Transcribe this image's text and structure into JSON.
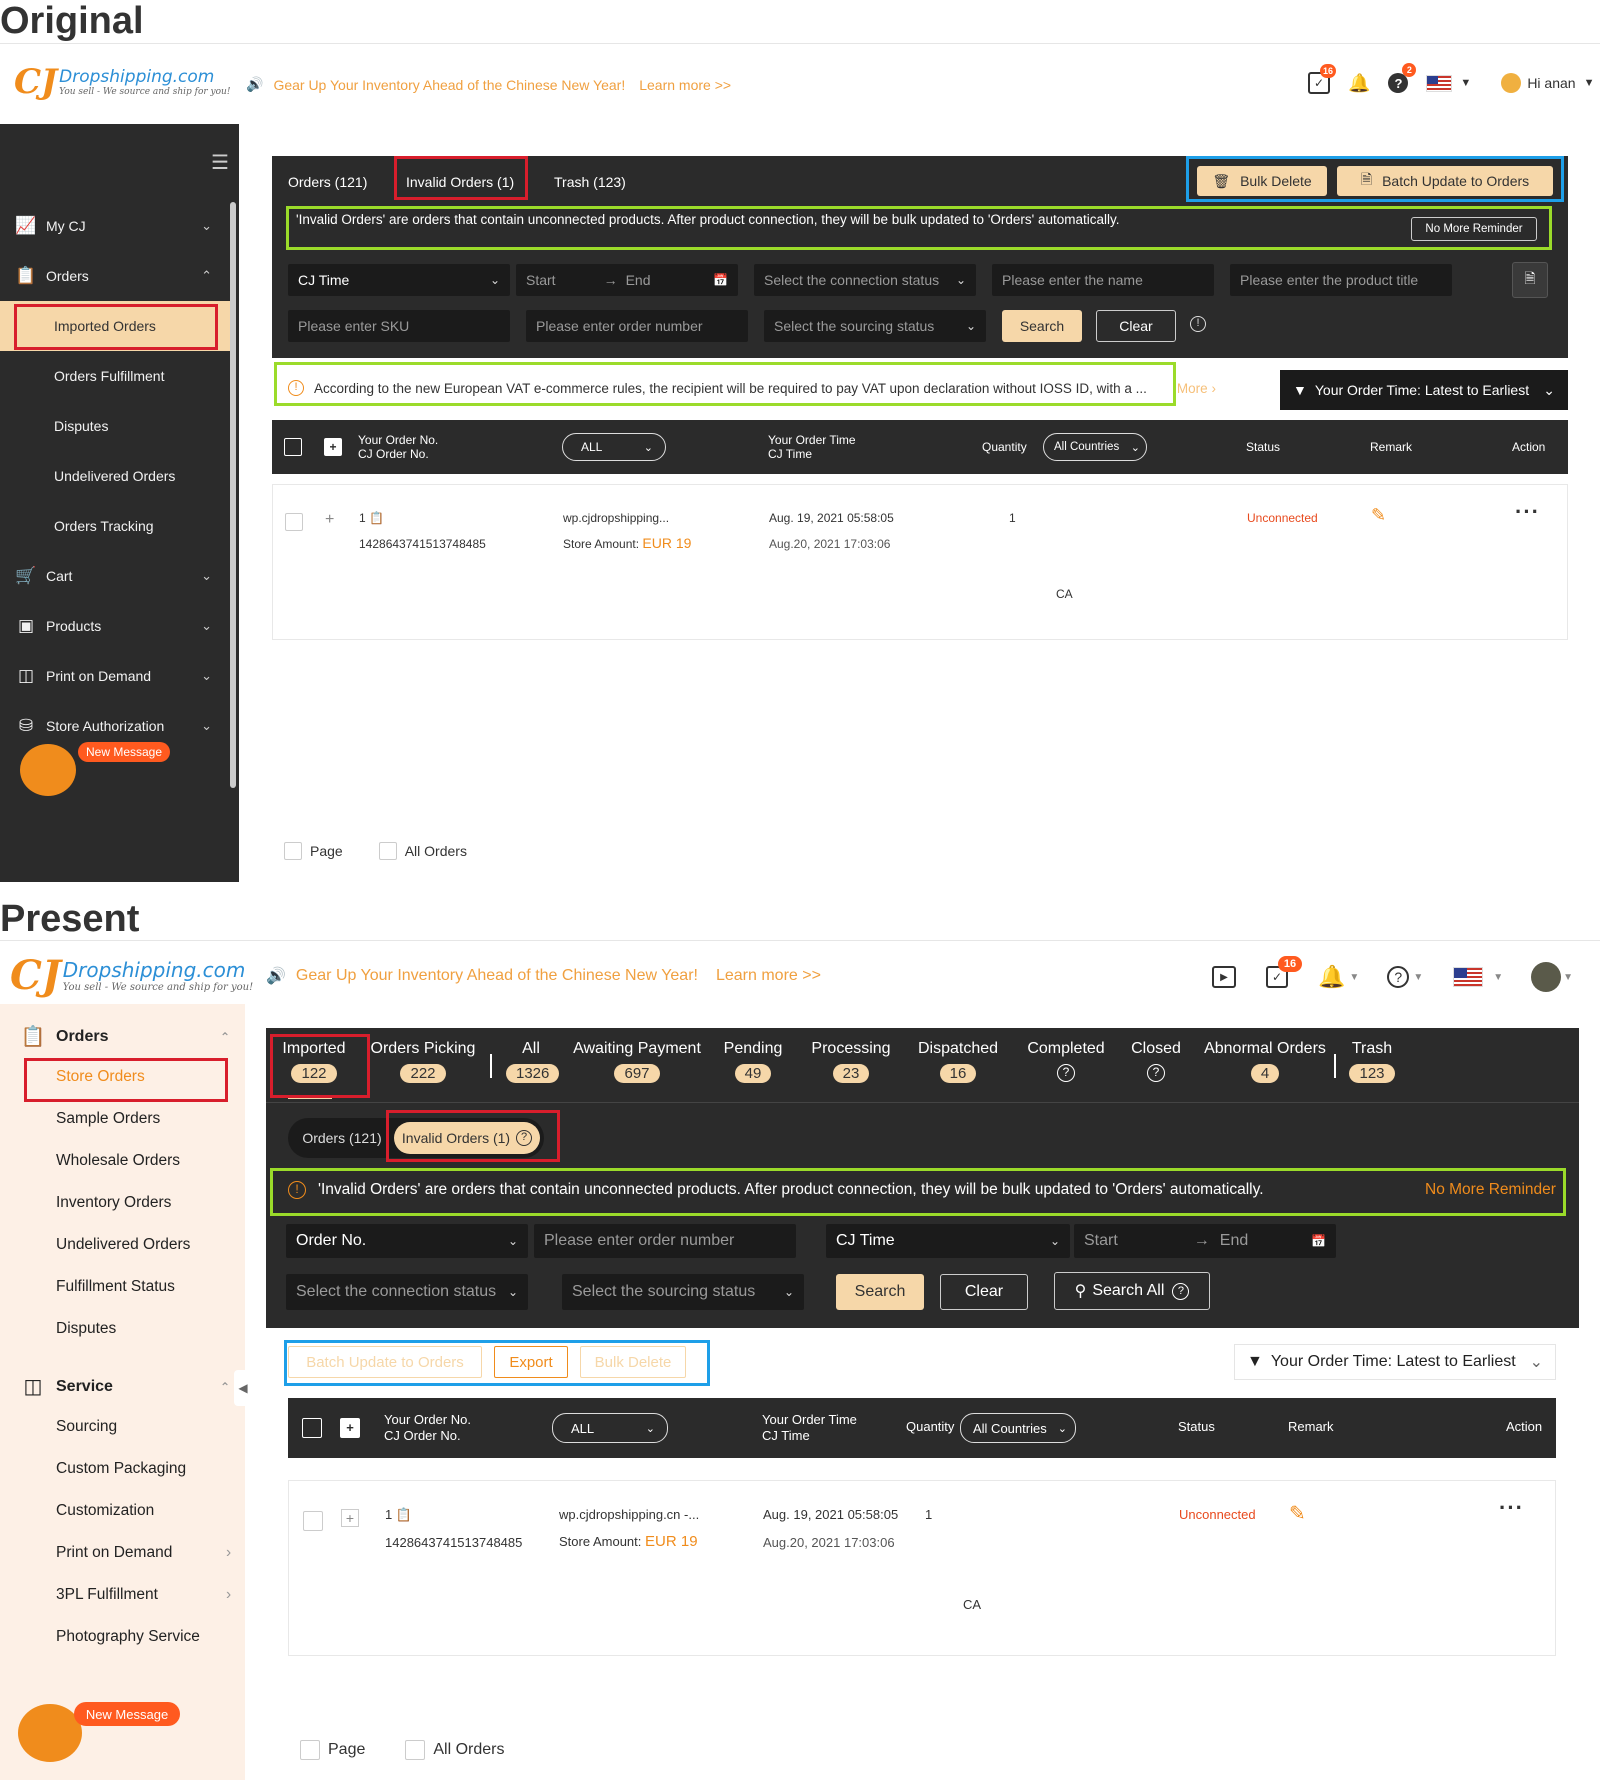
{
  "labels": {
    "original": "Original",
    "present": "Present"
  },
  "header": {
    "logo_cj": "CJ",
    "logo_name": "Dropshipping.com",
    "logo_tagline": "You sell - We source and ship for you!",
    "announcement": "Gear Up Your Inventory Ahead of the Chinese New Year!",
    "learn_more": "Learn more >>",
    "top_badge_orders": "16",
    "top_badge_help": "2",
    "greeting": "Hi anan",
    "bottom_badge_orders": "16"
  },
  "top": {
    "sidebar": {
      "my_cj": "My CJ",
      "orders": "Orders",
      "subs": [
        "Imported Orders",
        "Orders Fulfillment",
        "Disputes",
        "Undelivered Orders",
        "Orders Tracking"
      ],
      "cart": "Cart",
      "products": "Products",
      "print_on_demand": "Print on Demand",
      "store_authorization": "Store Authorization",
      "new_message": "New Message"
    },
    "tabs": {
      "orders": "Orders (121)",
      "invalid": "Invalid Orders (1)",
      "trash": "Trash (123)"
    },
    "bulk_delete": "Bulk Delete",
    "batch_update": "Batch Update to Orders",
    "notice": "'Invalid Orders' are orders that contain unconnected products. After product connection, they will be bulk updated to 'Orders' automatically.",
    "no_more_reminder": "No More Reminder",
    "filters": {
      "cj_time": "CJ Time",
      "start": "Start",
      "end": "End",
      "connection": "Select the connection status",
      "name": "Please enter the name",
      "product_title": "Please enter the product title",
      "sku": "Please enter SKU",
      "order_number": "Please enter order number",
      "sourcing": "Select the sourcing status",
      "search": "Search",
      "clear": "Clear"
    },
    "vat_notice": "According to the new European VAT e-commerce rules, the recipient will be required to pay VAT upon declaration without IOSS ID, with a ...",
    "more": "More",
    "sort": "Your Order Time: Latest to Earliest",
    "table_head": {
      "order_no": "Your Order No.",
      "cj_order_no": "CJ Order No.",
      "all": "ALL",
      "order_time": "Your Order Time",
      "cj_time": "CJ Time",
      "quantity": "Quantity",
      "all_countries": "All Countries",
      "status": "Status",
      "remark": "Remark",
      "action": "Action"
    },
    "row": {
      "index": "1",
      "cj_no": "1428643741513748485",
      "store": "wp.cjdropshipping...",
      "store_amount_label": "Store Amount:",
      "store_amount": "EUR 19",
      "order_time": "Aug. 19, 2021 05:58:05",
      "cj_time": "Aug.20, 2021 17:03:06",
      "quantity": "1",
      "status": "Unconnected",
      "country": "CA"
    },
    "footer": {
      "page": "Page",
      "all_orders": "All Orders"
    }
  },
  "bottom": {
    "sidebar": {
      "orders": "Orders",
      "order_subs": [
        "Store Orders",
        "Sample Orders",
        "Wholesale Orders",
        "Inventory Orders",
        "Undelivered Orders",
        "Fulfillment Status",
        "Disputes"
      ],
      "service": "Service",
      "service_subs": [
        "Sourcing",
        "Custom Packaging",
        "Customization",
        "Print on Demand",
        "3PL Fulfillment",
        "Photography Service"
      ],
      "new_message": "New Message"
    },
    "status_tabs": [
      {
        "label": "Imported",
        "count": "122"
      },
      {
        "label": "Orders Picking",
        "count": "222"
      },
      {
        "label": "All",
        "count": "1326"
      },
      {
        "label": "Awaiting Payment",
        "count": "697"
      },
      {
        "label": "Pending",
        "count": "49"
      },
      {
        "label": "Processing",
        "count": "23"
      },
      {
        "label": "Dispatched",
        "count": "16"
      },
      {
        "label": "Completed",
        "count": "?"
      },
      {
        "label": "Closed",
        "count": "?"
      },
      {
        "label": "Abnormal Orders",
        "count": "4"
      },
      {
        "label": "Trash",
        "count": "123"
      }
    ],
    "seg_orders": "Orders (121)",
    "seg_invalid": "Invalid Orders (1)",
    "notice": "'Invalid Orders' are orders that contain unconnected products. After product connection, they will be bulk updated to 'Orders' automatically.",
    "no_more_reminder": "No More Reminder",
    "filters": {
      "order_no": "Order No.",
      "order_number": "Please enter order number",
      "cj_time": "CJ Time",
      "start": "Start",
      "end": "End",
      "connection": "Select the connection status",
      "sourcing": "Select the sourcing status",
      "search": "Search",
      "clear": "Clear",
      "search_all": "Search All"
    },
    "actions": {
      "batch_update": "Batch Update to Orders",
      "export": "Export",
      "bulk_delete": "Bulk Delete"
    },
    "sort": "Your Order Time: Latest to Earliest",
    "table_head": {
      "order_no": "Your Order No.",
      "cj_order_no": "CJ Order No.",
      "all": "ALL",
      "order_time": "Your Order Time",
      "cj_time": "CJ Time",
      "quantity": "Quantity",
      "all_countries": "All Countries",
      "status": "Status",
      "remark": "Remark",
      "action": "Action"
    },
    "row": {
      "index": "1",
      "cj_no": "1428643741513748485",
      "store": "wp.cjdropshipping.cn -...",
      "store_amount_label": "Store Amount:",
      "store_amount": "EUR 19",
      "order_time": "Aug. 19, 2021 05:58:05",
      "cj_time": "Aug.20, 2021 17:03:06",
      "quantity": "1",
      "status": "Unconnected",
      "country": "CA"
    },
    "footer": {
      "page": "Page",
      "all_orders": "All Orders"
    }
  }
}
